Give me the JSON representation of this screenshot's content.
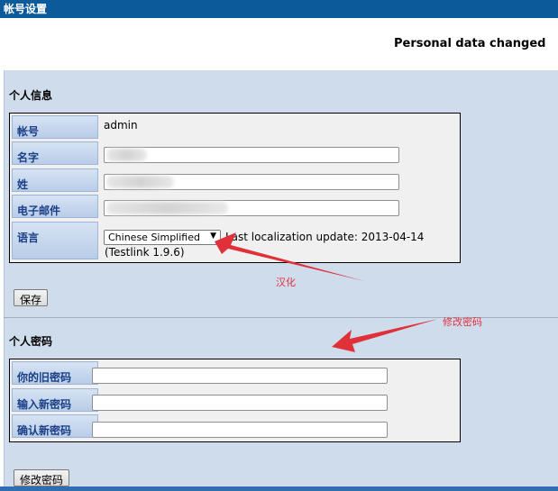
{
  "window": {
    "title": "帐号设置"
  },
  "status_message": "Personal data changed",
  "personal_info": {
    "title": "个人信息",
    "rows": [
      {
        "label": "帐号",
        "value": "admin"
      },
      {
        "label": "名字",
        "value": ""
      },
      {
        "label": "姓",
        "value": ""
      },
      {
        "label": "电子邮件",
        "value": ""
      },
      {
        "label": "语言"
      }
    ],
    "language": {
      "selected": "Chinese Simplified",
      "note_line1": "Last localization update: 2013-04-14",
      "note_line2": "(Testlink 1.9.6)"
    },
    "save_label": "保存"
  },
  "password": {
    "title": "个人密码",
    "rows": [
      {
        "label": "你的旧密码"
      },
      {
        "label": "输入新密码"
      },
      {
        "label": "确认新密码"
      }
    ],
    "change_label": "修改密码"
  },
  "annotations": {
    "localize": "汉化",
    "change_password": "修改密码"
  },
  "colors": {
    "titlebar": "#0d5a9b",
    "panel": "#cfdcec",
    "label_text": "#1b3f87",
    "annotation": "#e0313b"
  }
}
